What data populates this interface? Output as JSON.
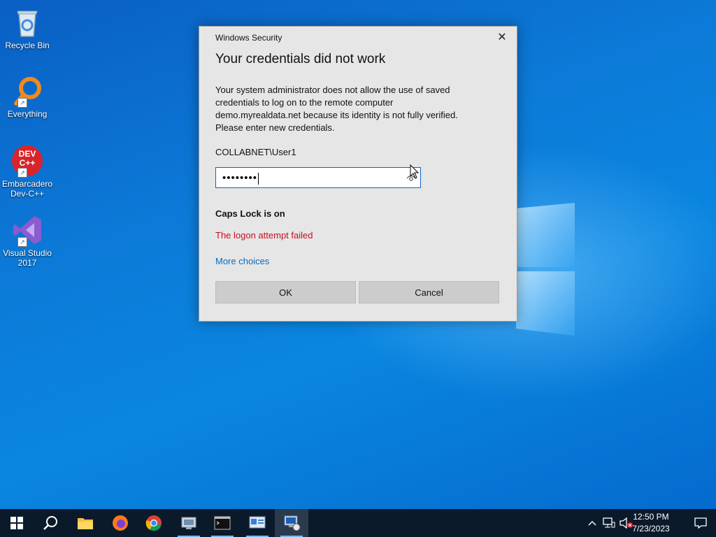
{
  "desktop": {
    "icons": [
      {
        "label": "Recycle Bin"
      },
      {
        "label": "Everything"
      },
      {
        "label": "Embarcadero Dev-C++"
      },
      {
        "label": "Visual Studio 2017"
      }
    ],
    "devcpp_badge": "DEV C++"
  },
  "dialog": {
    "app_name": "Windows Security",
    "close_glyph": "✕",
    "title": "Your credentials did not work",
    "message": "Your system administrator does not allow the use of saved\ncredentials to log on to the remote computer\ndemo.myrealdata.net because its identity is not fully verified.\nPlease enter new credentials.",
    "username": "COLLABNET\\User1",
    "password_masked": "••••••••",
    "caps_lock_warning": "Caps Lock is on",
    "error": "The logon attempt failed",
    "more_choices": "More choices",
    "ok_label": "OK",
    "cancel_label": "Cancel"
  },
  "taskbar": {
    "apps": [
      "start-icon",
      "search-icon",
      "file-explorer-icon",
      "firefox-icon",
      "chrome-icon",
      "control-panel-icon",
      "terminal-icon",
      "system-settings-icon",
      "remote-desktop-icon"
    ],
    "clock_time": "12:50 PM",
    "clock_date": "7/23/2023"
  },
  "colors": {
    "error_red": "#c50f1f",
    "link_blue": "#0a6cbd",
    "accent": "#0078d7"
  }
}
